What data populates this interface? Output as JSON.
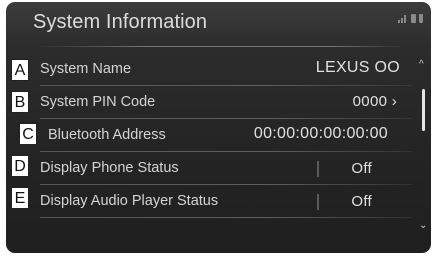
{
  "screen": {
    "title": "System Information"
  },
  "status_icons": [
    "signal-icon",
    "bluetooth-icon",
    "battery-icon"
  ],
  "rows": [
    {
      "badge": "A",
      "label": "System Name",
      "value": "LEXUS OO",
      "chevron": "^"
    },
    {
      "badge": "B",
      "label": "System PIN Code",
      "value": "0000 ›"
    },
    {
      "badge": "C",
      "label": "Bluetooth Address",
      "value": "00:00:00:00:00:00"
    },
    {
      "badge": "D",
      "label": "Display Phone Status",
      "value": "Off"
    },
    {
      "badge": "E",
      "label": "Display Audio Player Status",
      "value": "Off"
    }
  ],
  "scroll": {
    "up_icon": "^",
    "down_icon": "⌄"
  }
}
